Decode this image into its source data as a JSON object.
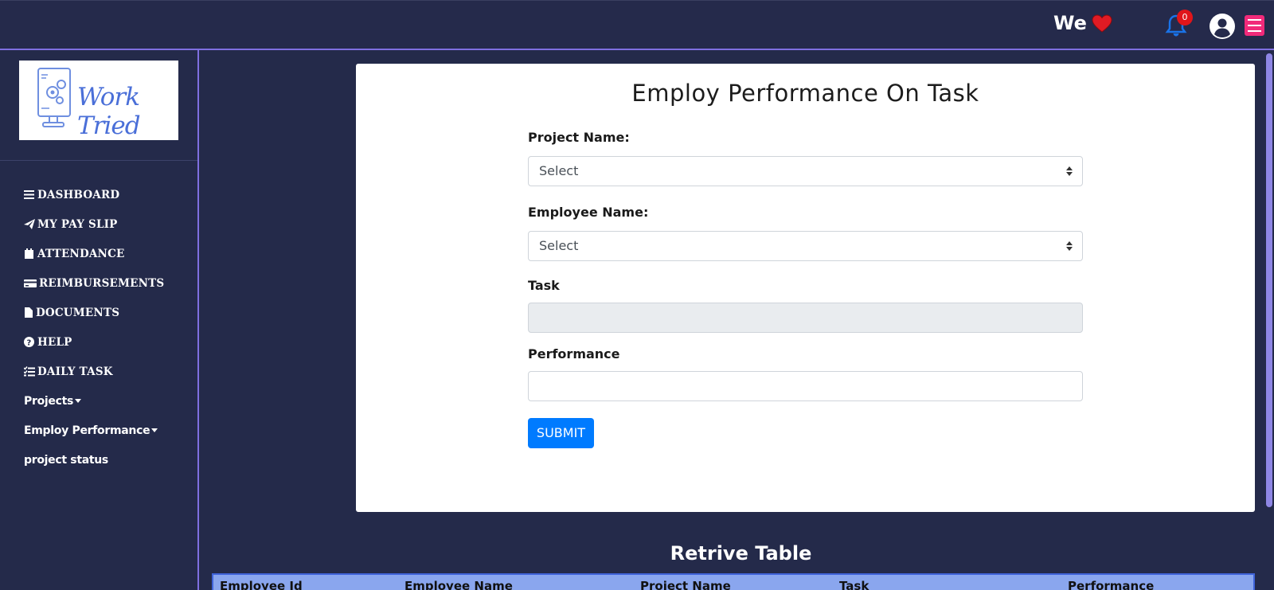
{
  "topbar": {
    "we_text": "We",
    "notification_count": "0",
    "colors": {
      "heart": "#e01b24",
      "bell": "#1a73e8",
      "menu": "#f12a7a"
    }
  },
  "sidebar": {
    "logo_text": "Work Tried",
    "items": [
      {
        "label": "DASHBOARD",
        "icon": "bars-icon"
      },
      {
        "label": "MY PAY SLIP",
        "icon": "paper-plane-icon"
      },
      {
        "label": "ATTENDANCE",
        "icon": "calendar-icon"
      },
      {
        "label": "REIMBURSEMENTS",
        "icon": "credit-card-icon"
      },
      {
        "label": "DOCUMENTS",
        "icon": "file-icon"
      },
      {
        "label": "HELP",
        "icon": "question-circle-icon"
      },
      {
        "label": "DAILY TASK",
        "icon": "tasks-icon"
      },
      {
        "label": "Projects",
        "icon": "caret-down-icon"
      },
      {
        "label": "Employ Performance",
        "icon": "caret-down-icon"
      },
      {
        "label": "project status",
        "icon": ""
      }
    ]
  },
  "form": {
    "title": "Employ Performance On Task",
    "project_label": "Project Name:",
    "project_value": "Select",
    "employee_label": "Employee Name:",
    "employee_value": "Select",
    "task_label": "Task",
    "performance_label": "Performance",
    "submit_label": "SUBMIT"
  },
  "table": {
    "title": "Retrive Table",
    "headers": [
      "Employee Id",
      "Employee Name",
      "Project Name",
      "Task",
      "Performance"
    ]
  }
}
